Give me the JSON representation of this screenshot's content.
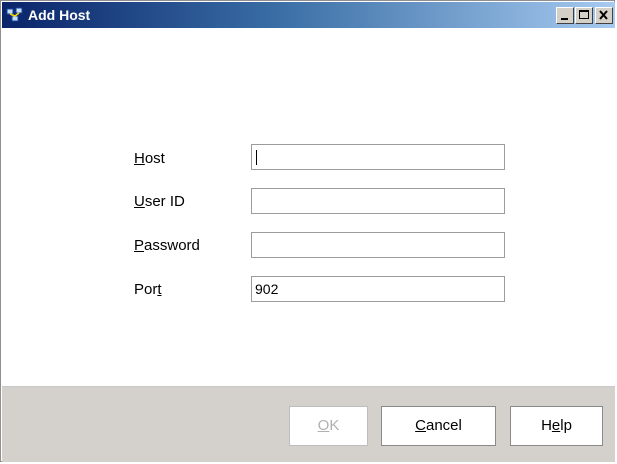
{
  "window": {
    "title": "Add Host",
    "app_icon": "network-hosts-icon",
    "controls": [
      "minimize-icon",
      "maximize-icon",
      "close-icon"
    ]
  },
  "form": {
    "host": {
      "label_mnemonic": "H",
      "label_rest": "ost",
      "value": ""
    },
    "user_id": {
      "label_mnemonic": "U",
      "label_rest": "ser ID",
      "value": ""
    },
    "password": {
      "label_mnemonic": "P",
      "label_rest": "assword",
      "value": ""
    },
    "port": {
      "label_before": "Por",
      "label_mnemonic": "t",
      "value": "902"
    }
  },
  "buttons": {
    "ok": {
      "mnemonic": "O",
      "rest": "K",
      "enabled": false
    },
    "cancel": {
      "mnemonic": "C",
      "rest": "ancel"
    },
    "help": {
      "before": "H",
      "mnemonic": "e",
      "rest": "lp"
    }
  },
  "colors": {
    "titlebar_start": "#0a246a",
    "titlebar_end": "#a6caf0",
    "footer_bg": "#d4d0cb"
  }
}
